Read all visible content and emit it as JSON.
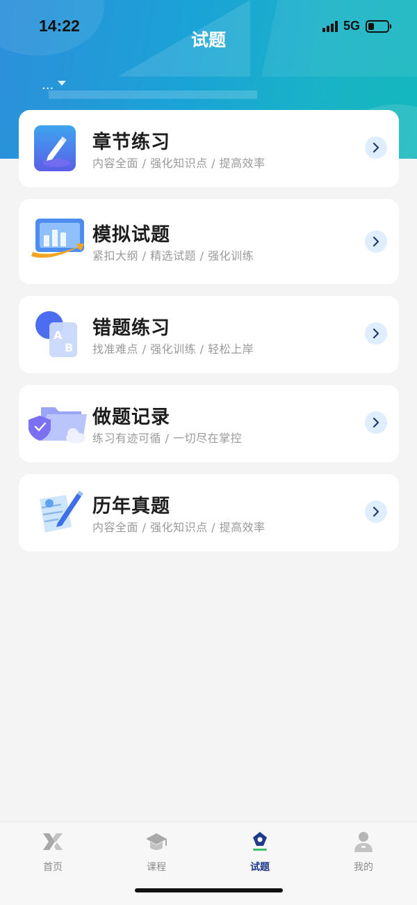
{
  "status_bar": {
    "time": "14:22",
    "network": "5G",
    "battery_level": 0.3
  },
  "header": {
    "title": "试题",
    "subject_selector": "..."
  },
  "cards": [
    {
      "title": "章节练习",
      "subtitle": "内容全面 / 强化知识点 / 提高效率",
      "icon": "pencil-book-icon"
    },
    {
      "title": "模拟试题",
      "subtitle": "紧扣大纲 / 精选试题 / 强化训练",
      "icon": "chart-screen-icon"
    },
    {
      "title": "错题练习",
      "subtitle": "找准难点 / 强化训练 / 轻松上岸",
      "icon": "ab-document-icon"
    },
    {
      "title": "做题记录",
      "subtitle": "练习有迹可循 / 一切尽在掌控",
      "icon": "folder-shield-icon"
    },
    {
      "title": "历年真题",
      "subtitle": "内容全面 / 强化知识点 / 提高效率",
      "icon": "pen-paper-icon"
    }
  ],
  "tabbar": {
    "items": [
      {
        "label": "首页",
        "icon": "home-logo-icon",
        "active": false
      },
      {
        "label": "课程",
        "icon": "graduation-cap-icon",
        "active": false
      },
      {
        "label": "试题",
        "icon": "pen-nib-icon",
        "active": true
      },
      {
        "label": "我的",
        "icon": "user-icon",
        "active": false
      }
    ]
  },
  "colors": {
    "header_gradient_start": "#2d8fdb",
    "header_gradient_end": "#14b8bd",
    "arrow_button_bg": "#dfeefc",
    "active_tab": "#1e3a8a"
  }
}
